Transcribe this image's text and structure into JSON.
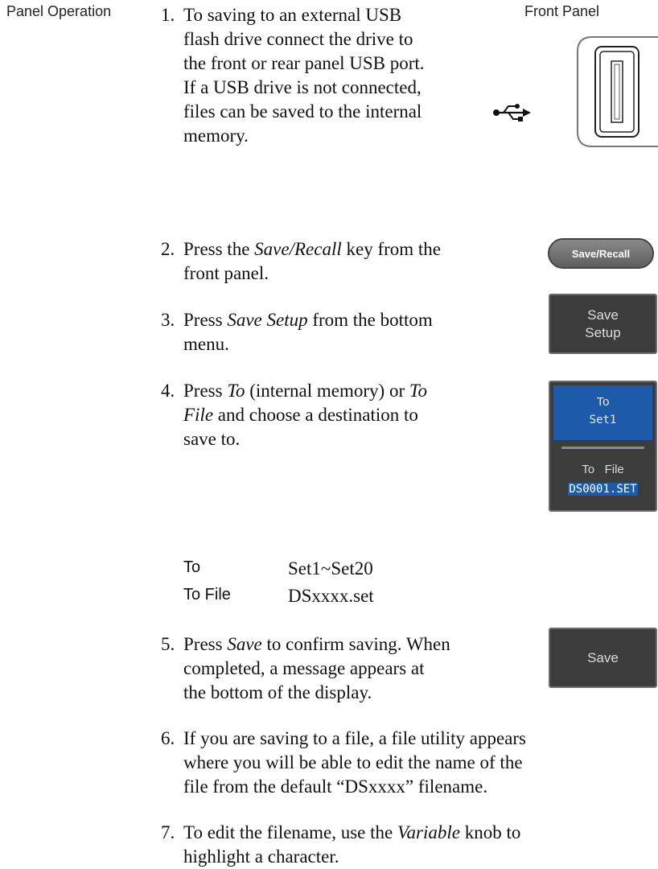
{
  "section_label": "Panel Operation",
  "front_panel_label": "Front Panel",
  "steps": [
    {
      "num": "1.",
      "lines": [
        "To saving to an external USB",
        "flash drive connect the drive to",
        "the front or rear panel USB port.",
        "If a USB drive is not connected,",
        "files can be saved to the internal",
        "memory."
      ]
    },
    {
      "num": "2.",
      "pre": "Press the ",
      "em": "Save/Recall",
      "post": " key from the",
      "line2": "front panel."
    },
    {
      "num": "3.",
      "pre": "Press ",
      "em": "Save Setup",
      "post": " from the bottom",
      "line2": "menu."
    },
    {
      "num": "4.",
      "l1_pre": "Press ",
      "l1_em": "To",
      "l1_mid": " (internal memory) or ",
      "l1_em2": "To",
      "l2_em": "File",
      "l2_post": " and choose a destination to",
      "line3": "save to."
    },
    {
      "num": "5.",
      "pre": "Press ",
      "em": "Save",
      "post": " to confirm saving. When",
      "line2": "completed, a message appears at",
      "line3": "the bottom of the display."
    },
    {
      "num": "6.",
      "lines": [
        "If you are saving to a file, a file utility appears",
        "where you will be able to edit the name of the",
        "file from the default “DSxxxx” filename."
      ]
    },
    {
      "num": "7.",
      "pre": "To edit the filename, use the ",
      "em": "Variable",
      "post": " knob to",
      "line2": "highlight a character."
    }
  ],
  "options": [
    {
      "key": "To",
      "value": "Set1~Set20"
    },
    {
      "key": "To File",
      "value": "DSxxxx.set"
    }
  ],
  "buttons": {
    "save_recall": "Save/Recall",
    "save_setup_l1": "Save",
    "save_setup_l2": "Setup",
    "to_label": "To",
    "to_value": "Set1",
    "to_file_l1a": "To",
    "to_file_l1b": "File",
    "to_file_value": "DS0001.SET",
    "save": "Save"
  },
  "icons": {
    "usb_symbol": "usb-icon",
    "usb_port": "usb-port-icon"
  }
}
